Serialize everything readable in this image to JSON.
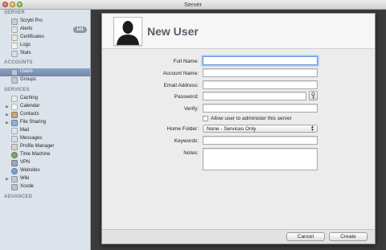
{
  "window": {
    "title": "Server"
  },
  "sidebar": {
    "sections": [
      {
        "label": "SERVER"
      },
      {
        "label": "ACCOUNTS"
      },
      {
        "label": "SERVICES"
      },
      {
        "label": "ADVANCED"
      }
    ],
    "server_items": [
      {
        "label": "Scrybl Pro",
        "icon": "server-icon"
      },
      {
        "label": "Alerts",
        "icon": "alert-icon",
        "badge": "141"
      },
      {
        "label": "Certificates",
        "icon": "certificate-icon"
      },
      {
        "label": "Logs",
        "icon": "logs-icon"
      },
      {
        "label": "Stats",
        "icon": "stats-icon"
      }
    ],
    "account_items": [
      {
        "label": "Users",
        "icon": "user-icon",
        "selected": true
      },
      {
        "label": "Groups",
        "icon": "group-icon"
      }
    ],
    "service_items": [
      {
        "label": "Caching",
        "icon": "caching-icon"
      },
      {
        "label": "Calendar",
        "icon": "calendar-icon",
        "expandable": true
      },
      {
        "label": "Contacts",
        "icon": "contacts-icon",
        "expandable": true
      },
      {
        "label": "File Sharing",
        "icon": "file-sharing-icon",
        "expandable": true
      },
      {
        "label": "Mail",
        "icon": "mail-icon"
      },
      {
        "label": "Messages",
        "icon": "messages-icon"
      },
      {
        "label": "Profile Manager",
        "icon": "profile-manager-icon"
      },
      {
        "label": "Time Machine",
        "icon": "time-machine-icon"
      },
      {
        "label": "VPN",
        "icon": "vpn-icon"
      },
      {
        "label": "Websites",
        "icon": "websites-icon"
      },
      {
        "label": "Wiki",
        "icon": "wiki-icon",
        "expandable": true
      },
      {
        "label": "Xcode",
        "icon": "xcode-icon"
      }
    ]
  },
  "sheet": {
    "title": "New User",
    "fields": {
      "full_name": {
        "label": "Full Name:",
        "value": ""
      },
      "account_name": {
        "label": "Account Name:",
        "value": ""
      },
      "email": {
        "label": "Email Address:",
        "value": ""
      },
      "password": {
        "label": "Password:",
        "value": ""
      },
      "verify": {
        "label": "Verify:",
        "value": ""
      },
      "admin_checkbox": {
        "label": "Allow user to administer this server",
        "checked": false
      },
      "home_folder": {
        "label": "Home Folder:",
        "selected": "None - Services Only"
      },
      "keywords": {
        "label": "Keywords:",
        "value": ""
      },
      "notes": {
        "label": "Notes:",
        "value": ""
      }
    },
    "buttons": {
      "cancel": "Cancel",
      "create": "Create"
    }
  },
  "colors": {
    "sidebar_bg": "#dde3ea",
    "selection": "#7289ad",
    "focus_ring": "#6a9be0",
    "badge": "#8b97a6"
  }
}
